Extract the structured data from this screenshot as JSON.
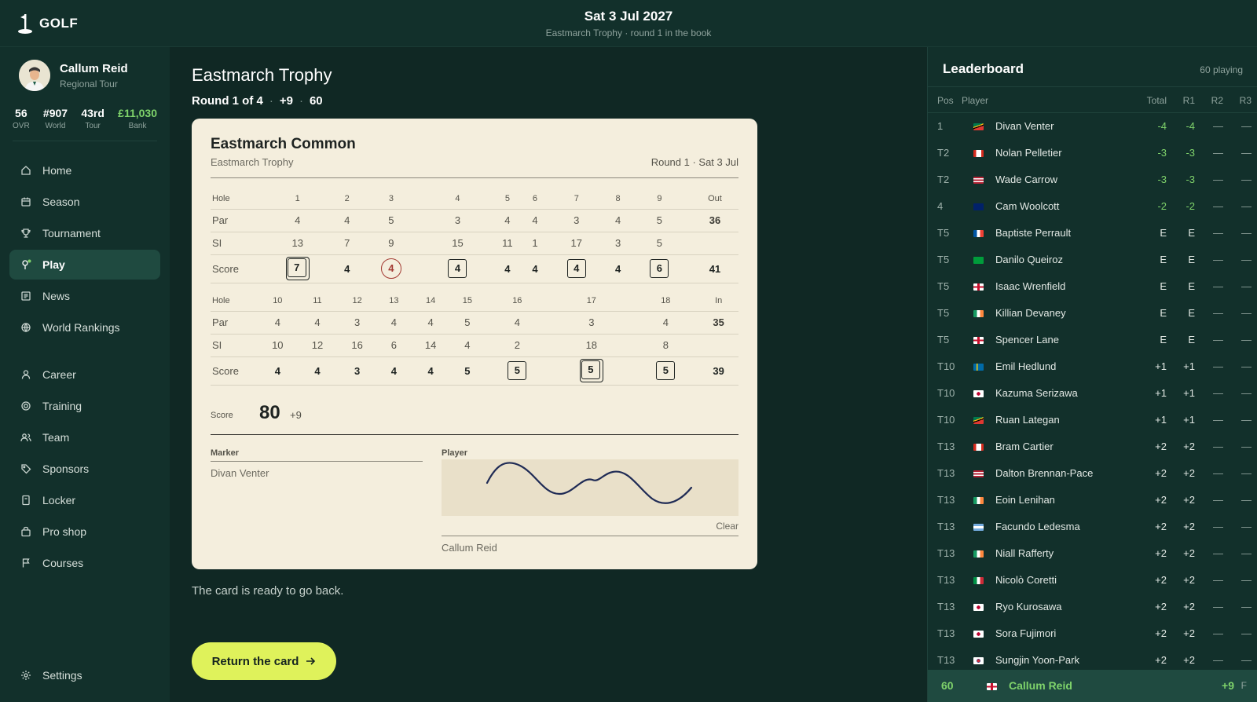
{
  "app": {
    "logo_text": "GOLF"
  },
  "header": {
    "date": "Sat 3 Jul 2027",
    "subtitle": "Eastmarch Trophy · round 1 in the book"
  },
  "profile": {
    "name": "Callum Reid",
    "tour": "Regional Tour"
  },
  "stats": [
    {
      "value": "56",
      "label": "OVR"
    },
    {
      "value": "#907",
      "label": "World"
    },
    {
      "value": "43rd",
      "label": "Tour"
    },
    {
      "value": "£11,030",
      "label": "Bank"
    }
  ],
  "nav": [
    {
      "label": "Home",
      "icon": "home-icon"
    },
    {
      "label": "Season",
      "icon": "calendar-icon"
    },
    {
      "label": "Tournament",
      "icon": "trophy-icon"
    },
    {
      "label": "Play",
      "icon": "flag-pin-icon"
    },
    {
      "label": "News",
      "icon": "newspaper-icon"
    },
    {
      "label": "World Rankings",
      "icon": "globe-icon"
    },
    {
      "label": "Career",
      "icon": "user-icon"
    },
    {
      "label": "Training",
      "icon": "target-icon"
    },
    {
      "label": "Team",
      "icon": "team-icon"
    },
    {
      "label": "Sponsors",
      "icon": "tag-icon"
    },
    {
      "label": "Locker",
      "icon": "locker-icon"
    },
    {
      "label": "Pro shop",
      "icon": "bag-icon"
    },
    {
      "label": "Courses",
      "icon": "course-flag-icon"
    },
    {
      "label": "Settings",
      "icon": "gear-icon"
    }
  ],
  "main": {
    "title": "Eastmarch Trophy",
    "round": "Round 1 of 4",
    "to_par": "+9",
    "position": "60",
    "ready_text": "The card is ready to go back.",
    "return_label": "Return the card"
  },
  "card": {
    "course": "Eastmarch Common",
    "tournament": "Eastmarch Trophy",
    "round_date": "Round 1 · Sat 3 Jul",
    "row_labels": {
      "hole": "Hole",
      "par": "Par",
      "si": "SI",
      "score": "Score"
    },
    "front": {
      "holes": [
        "1",
        "2",
        "3",
        "4",
        "5",
        "6",
        "7",
        "8",
        "9"
      ],
      "total_label": "Out",
      "par": [
        "4",
        "4",
        "5",
        "3",
        "4",
        "4",
        "3",
        "4",
        "5"
      ],
      "par_total": "36",
      "si": [
        "13",
        "7",
        "9",
        "15",
        "11",
        "1",
        "17",
        "3",
        "5"
      ],
      "score": [
        "7",
        "4",
        "4",
        "4",
        "4",
        "4",
        "4",
        "4",
        "6"
      ],
      "score_total": "41"
    },
    "back": {
      "holes": [
        "10",
        "11",
        "12",
        "13",
        "14",
        "15",
        "16",
        "17",
        "18"
      ],
      "total_label": "In",
      "par": [
        "4",
        "4",
        "3",
        "4",
        "4",
        "5",
        "4",
        "3",
        "4"
      ],
      "par_total": "35",
      "si": [
        "10",
        "12",
        "16",
        "6",
        "14",
        "4",
        "2",
        "18",
        "8"
      ],
      "score": [
        "4",
        "4",
        "3",
        "4",
        "4",
        "5",
        "5",
        "5",
        "5"
      ],
      "score_total": "39"
    },
    "score_label": "Score",
    "score_total": "80",
    "score_over": "+9",
    "marker_label": "Marker",
    "marker_name": "Divan Venter",
    "player_label": "Player",
    "clear_label": "Clear",
    "player_name": "Callum Reid"
  },
  "leaderboard": {
    "title": "Leaderboard",
    "count": "60 playing",
    "columns": [
      "Pos",
      "Player",
      "Total",
      "R1",
      "R2",
      "R3"
    ],
    "rows": [
      {
        "pos": "1",
        "name": "Divan Venter",
        "total": "-4",
        "r1": "-4",
        "r2": "—",
        "r3": "—",
        "flag": "ZA"
      },
      {
        "pos": "T2",
        "name": "Nolan Pelletier",
        "total": "-3",
        "r1": "-3",
        "r2": "—",
        "r3": "—",
        "flag": "CA"
      },
      {
        "pos": "T2",
        "name": "Wade Carrow",
        "total": "-3",
        "r1": "-3",
        "r2": "—",
        "r3": "—",
        "flag": "US"
      },
      {
        "pos": "4",
        "name": "Cam Woolcott",
        "total": "-2",
        "r1": "-2",
        "r2": "—",
        "r3": "—",
        "flag": "AU"
      },
      {
        "pos": "T5",
        "name": "Baptiste Perrault",
        "total": "E",
        "r1": "E",
        "r2": "—",
        "r3": "—",
        "flag": "FR"
      },
      {
        "pos": "T5",
        "name": "Danilo Queiroz",
        "total": "E",
        "r1": "E",
        "r2": "—",
        "r3": "—",
        "flag": "BR"
      },
      {
        "pos": "T5",
        "name": "Isaac Wrenfield",
        "total": "E",
        "r1": "E",
        "r2": "—",
        "r3": "—",
        "flag": "EN"
      },
      {
        "pos": "T5",
        "name": "Killian Devaney",
        "total": "E",
        "r1": "E",
        "r2": "—",
        "r3": "—",
        "flag": "IE"
      },
      {
        "pos": "T5",
        "name": "Spencer Lane",
        "total": "E",
        "r1": "E",
        "r2": "—",
        "r3": "—",
        "flag": "EN"
      },
      {
        "pos": "T10",
        "name": "Emil Hedlund",
        "total": "+1",
        "r1": "+1",
        "r2": "—",
        "r3": "—",
        "flag": "SE"
      },
      {
        "pos": "T10",
        "name": "Kazuma Serizawa",
        "total": "+1",
        "r1": "+1",
        "r2": "—",
        "r3": "—",
        "flag": "JP"
      },
      {
        "pos": "T10",
        "name": "Ruan Lategan",
        "total": "+1",
        "r1": "+1",
        "r2": "—",
        "r3": "—",
        "flag": "ZA"
      },
      {
        "pos": "T13",
        "name": "Bram Cartier",
        "total": "+2",
        "r1": "+2",
        "r2": "—",
        "r3": "—",
        "flag": "CA"
      },
      {
        "pos": "T13",
        "name": "Dalton Brennan-Pace",
        "total": "+2",
        "r1": "+2",
        "r2": "—",
        "r3": "—",
        "flag": "US"
      },
      {
        "pos": "T13",
        "name": "Eoin Lenihan",
        "total": "+2",
        "r1": "+2",
        "r2": "—",
        "r3": "—",
        "flag": "IE"
      },
      {
        "pos": "T13",
        "name": "Facundo Ledesma",
        "total": "+2",
        "r1": "+2",
        "r2": "—",
        "r3": "—",
        "flag": "AR"
      },
      {
        "pos": "T13",
        "name": "Niall Rafferty",
        "total": "+2",
        "r1": "+2",
        "r2": "—",
        "r3": "—",
        "flag": "IE"
      },
      {
        "pos": "T13",
        "name": "Nicolò Coretti",
        "total": "+2",
        "r1": "+2",
        "r2": "—",
        "r3": "—",
        "flag": "IT"
      },
      {
        "pos": "T13",
        "name": "Ryo Kurosawa",
        "total": "+2",
        "r1": "+2",
        "r2": "—",
        "r3": "—",
        "flag": "JP"
      },
      {
        "pos": "T13",
        "name": "Sora Fujimori",
        "total": "+2",
        "r1": "+2",
        "r2": "—",
        "r3": "—",
        "flag": "JP"
      },
      {
        "pos": "T13",
        "name": "Sungjin Yoon-Park",
        "total": "+2",
        "r1": "+2",
        "r2": "—",
        "r3": "—",
        "flag": "KR"
      }
    ],
    "me": {
      "pos": "60",
      "name": "Callum Reid",
      "total": "+9",
      "status": "F",
      "flag": "EN"
    }
  },
  "colors": {
    "accent": "#dff25b",
    "under_par": "#7fd36b",
    "card_bg": "#f4eedd",
    "bg": "#102824"
  }
}
